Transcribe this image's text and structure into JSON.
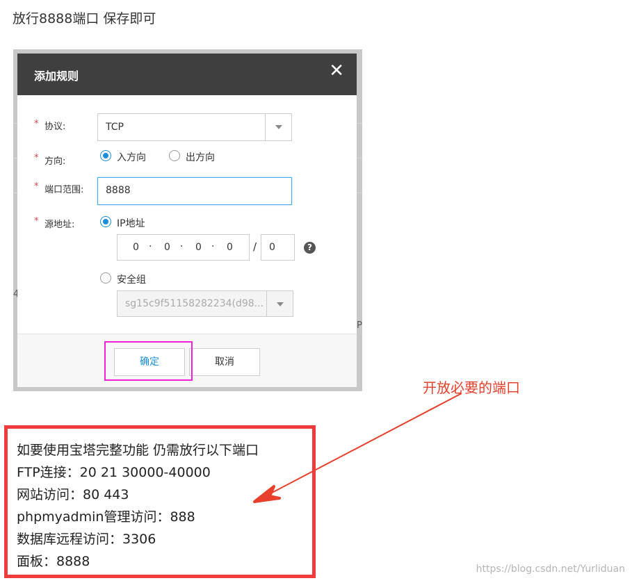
{
  "top_text": "放行8888端口 保存即可",
  "dialog": {
    "title": "添加规则",
    "close_symbol": "✕",
    "protocol": {
      "label": "协议:",
      "value": "TCP"
    },
    "direction": {
      "label": "方向:",
      "options": [
        "入方向",
        "出方向"
      ],
      "selected": "入方向"
    },
    "port_range": {
      "label": "端口范围:",
      "value": "8888"
    },
    "source": {
      "label": "源地址:",
      "ip_option": "IP地址",
      "ip_octets": [
        "0",
        "0",
        "0",
        "0",
        "0"
      ],
      "ip_separator": "·",
      "mask_separator": "/",
      "mask": "0",
      "help_symbol": "?",
      "group_option": "安全组",
      "group_value": "sg15c9f51158282234(d98..."
    },
    "required_mark": "*",
    "ok_label": "确定",
    "cancel_label": "取消"
  },
  "background_fragments": {
    "left": "4",
    "right": "P"
  },
  "annotation": "开放必要的端口",
  "info_lines": [
    "如要使用宝塔完整功能 仍需放行以下端口",
    "FTP连接：20 21 30000-40000",
    "网站访问：80 443",
    "phpmyadmin管理访问：888",
    "数据库远程访问：3306",
    "面板：8888"
  ],
  "watermark": "https://blog.csdn.net/Yurliduan",
  "colors": {
    "header_bg": "#3f3f3f",
    "accent_blue": "#1b8fd8",
    "required_red": "#e0454c",
    "highlight_magenta": "#ee22d8",
    "annotation_red": "#e8402a",
    "info_border_red": "#f03c3c"
  }
}
